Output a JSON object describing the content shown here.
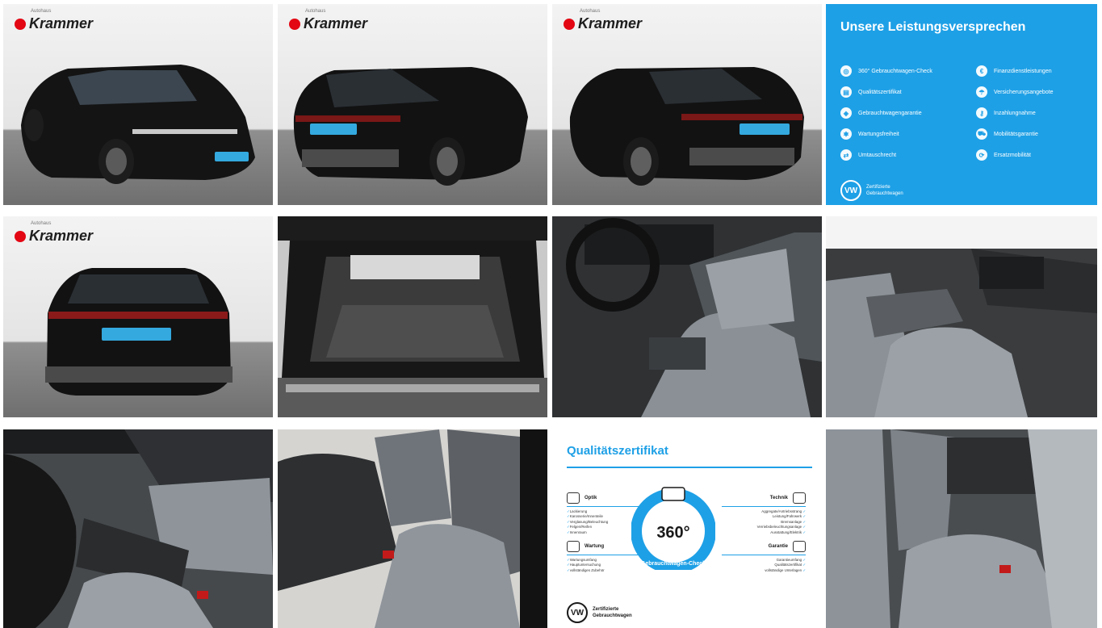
{
  "brand": {
    "name": "Krammer",
    "sub": "Autohaus"
  },
  "promise": {
    "title": "Unsere Leistungsversprechen",
    "left": [
      "360° Gebrauchtwagen-Check",
      "Qualitätszertifikat",
      "Gebrauchtwagengarantie",
      "Wartungsfreiheit",
      "Umtauschrecht"
    ],
    "right": [
      "Finanzdienstleistungen",
      "Versicherungsangebote",
      "Inzahlungnahme",
      "Mobilitätsgarantie",
      "Ersatzmobilität"
    ],
    "vw_line1": "Zertifizierte",
    "vw_line2": "Gebrauchtwagen"
  },
  "certificate": {
    "title": "Qualitätszertifikat",
    "optik": {
      "label": "Optik",
      "items": [
        "Lackierung",
        "Karosserie/Innenteile",
        "Verglasung/Beleuchtung",
        "Felgen/Reifen",
        "Innenraum"
      ]
    },
    "technik": {
      "label": "Technik",
      "items": [
        "Aggregate/Antriebsstrang",
        "Leistung/Fahrwerk",
        "Bremsanlage",
        "Verriebsbeleuchtungsanlage",
        "Ausstattung/Elektrik"
      ]
    },
    "wartung": {
      "label": "Wartung",
      "items": [
        "Wartungsumfang",
        "Hauptuntersuchung",
        "vollständiges Zubehör"
      ]
    },
    "garantie": {
      "label": "Garantie",
      "items": [
        "Garantieumfang",
        "Qualitätszertifikat",
        "vollständige Unterlagen"
      ]
    },
    "badge_number": "360°",
    "badge_text": "Gebrauchtwagen-Check",
    "vw_line1": "Zertifizierte",
    "vw_line2": "Gebrauchtwagen"
  },
  "colors": {
    "accent": "#1ea0e6",
    "brand_red": "#e30613"
  }
}
